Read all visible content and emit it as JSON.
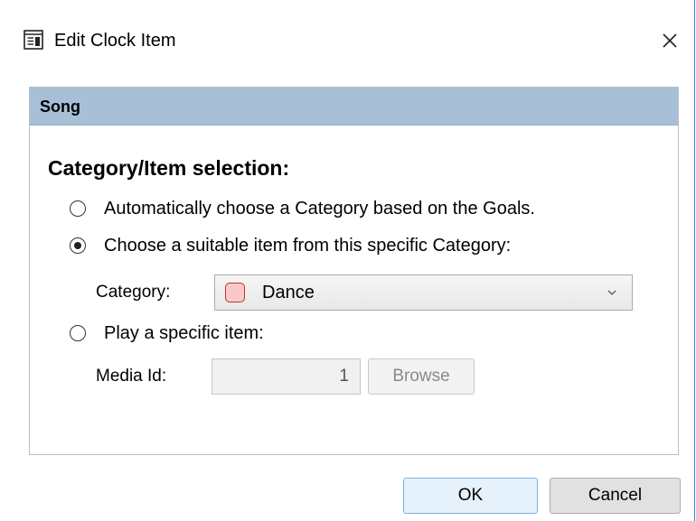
{
  "window": {
    "title": "Edit Clock Item",
    "icon": "clock-item-icon"
  },
  "panel": {
    "title": "Song",
    "section_title": "Category/Item selection:",
    "options": [
      {
        "label": "Automatically choose a Category based on the Goals.",
        "selected": false
      },
      {
        "label": "Choose a suitable item from this specific Category:",
        "selected": true
      },
      {
        "label": "Play a specific item:",
        "selected": false
      }
    ],
    "category": {
      "label": "Category:",
      "value": "Dance",
      "swatch_color": "#f9c9c9",
      "swatch_border": "#c0392b"
    },
    "media": {
      "label": "Media Id:",
      "value": "1",
      "browse_label": "Browse",
      "enabled": false
    }
  },
  "buttons": {
    "ok": "OK",
    "cancel": "Cancel"
  }
}
